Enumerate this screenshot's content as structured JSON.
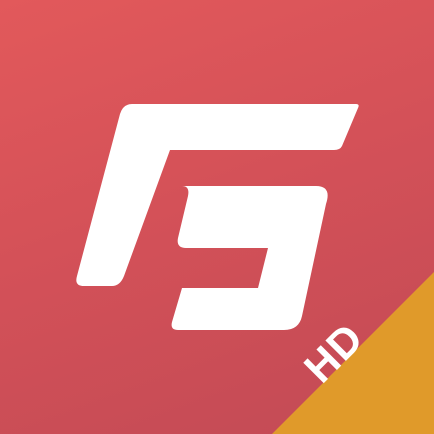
{
  "app_icon": {
    "logo_icon": "stylized-letter-g-logo",
    "badge": {
      "label": "HD"
    },
    "colors": {
      "background_top": "#e2595b",
      "background_bottom": "#c24a55",
      "logo": "#ffffff",
      "badge": "#e09a2a",
      "badge_text": "#ffffff"
    }
  }
}
